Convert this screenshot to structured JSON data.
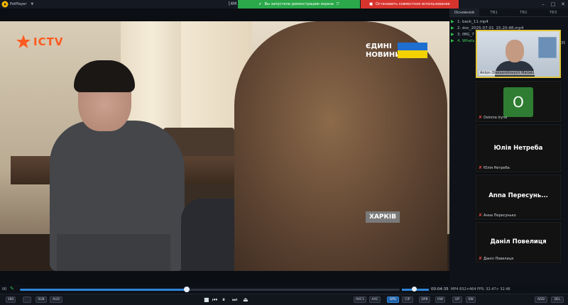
{
  "window": {
    "app_name": "PotPlayer",
    "menu_caret": "▼",
    "title": "[4M",
    "controls": [
      "–",
      "□",
      "✕"
    ]
  },
  "share_banner": {
    "sharing_text": "Вы запустили демонстрацию экрана",
    "stop_text": "Остановить совместное использование",
    "accent_green": "#2aa84a",
    "accent_red": "#d8342e"
  },
  "video": {
    "channel_logo": "ICTV",
    "news_logo_line1": "ЄДИНІ",
    "news_logo_line2": "НОВИНИ",
    "location_caption": "ХАРКІВ"
  },
  "playlist": {
    "tabs": [
      "Основной",
      "TB1",
      "TB2",
      "TB3"
    ],
    "items": [
      "1. back_11.mp4",
      "2. doc_2025-07-01_15-20-48.mp4",
      "3. IMG_7",
      "4. Whats"
    ],
    "scroll_marker": "35"
  },
  "participants": {
    "host_cam_label": "Anton Oleksandrovych Matiaki",
    "avatar_letter": "O",
    "tiles": [
      {
        "center": "",
        "label": "Osinnia Iryna"
      },
      {
        "center": "Юлія Нетреба",
        "label": "Юлія Нетреба"
      },
      {
        "center": "Anna Пересунь...",
        "label": "Анна Пересунько"
      },
      {
        "center": "Даніл Повелиця",
        "label": "Даніл Повелиця"
      }
    ]
  },
  "seek": {
    "left_label": "00",
    "elapsed_fraction": 0.44,
    "volume_fraction": 0.45,
    "time": "00:04:35",
    "file_info": "MP4  832×464  FPS: 32.47> 32.46"
  },
  "controls": {
    "left_pills": [
      "360",
      "SUB",
      "AUD"
    ],
    "transport": [
      "■",
      "⏮",
      "⏸",
      "⏭",
      "⏏"
    ],
    "right_pills": [
      "AVC1",
      "AAC",
      "GPU",
      "CIP",
      "DPB",
      "HW",
      "UP",
      "SW",
      "ADD",
      "DEL"
    ]
  }
}
